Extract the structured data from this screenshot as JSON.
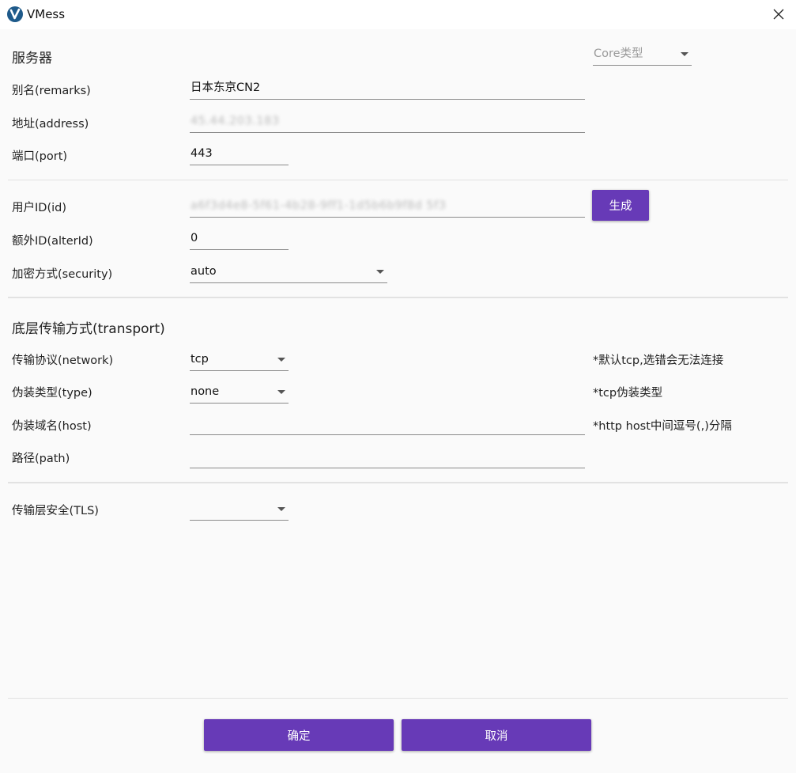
{
  "window": {
    "title": "VMess",
    "app_icon": "vmess-v-icon",
    "close_icon": "close-icon"
  },
  "server": {
    "section_title": "服务器",
    "core_type_placeholder": "Core类型",
    "remarks_label": "别名(remarks)",
    "remarks_value": "日本东京CN2",
    "address_label": "地址(address)",
    "address_value": "45.44.203.183",
    "port_label": "端口(port)",
    "port_value": "443"
  },
  "user": {
    "id_label": "用户ID(id)",
    "id_value": "a6f3d4e8-5f61-4b28-9ff1-1d5b6b9f8d 5f3",
    "generate_button": "生成",
    "alterid_label": "额外ID(alterId)",
    "alterid_value": "0",
    "security_label": "加密方式(security)",
    "security_value": "auto"
  },
  "transport": {
    "section_title": "底层传输方式(transport)",
    "network_label": "传输协议(network)",
    "network_value": "tcp",
    "network_hint": "*默认tcp,选错会无法连接",
    "type_label": "伪装类型(type)",
    "type_value": "none",
    "type_hint": "*tcp伪装类型",
    "host_label": "伪装域名(host)",
    "host_value": "",
    "host_hint": "*http host中间逗号(,)分隔",
    "path_label": "路径(path)",
    "path_value": ""
  },
  "tls": {
    "label": "传输层安全(TLS)",
    "value": ""
  },
  "footer": {
    "ok_button": "确定",
    "cancel_button": "取消"
  },
  "colors": {
    "accent": "#673ab7",
    "background": "#fafafa",
    "titlebar": "#ffffff"
  }
}
